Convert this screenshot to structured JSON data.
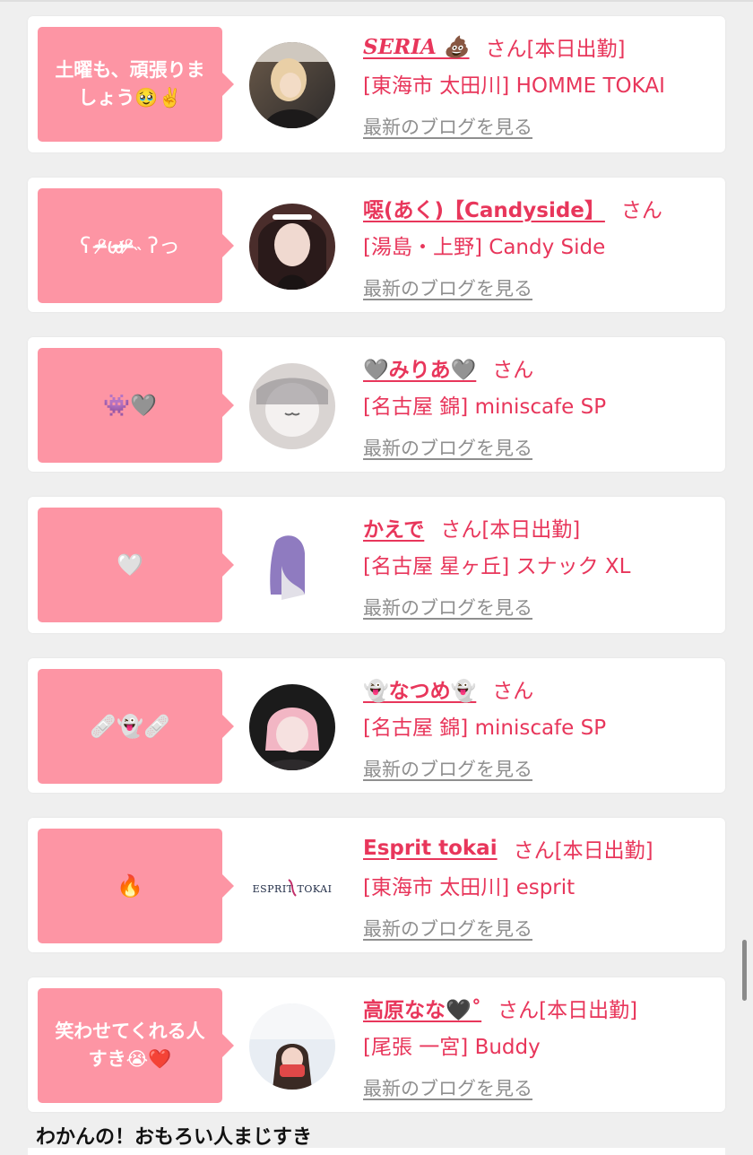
{
  "cards": [
    {
      "bubble": "土曜も、頑張りま\nしょう🥹✌️",
      "name": "SERIA 💩",
      "suffix": "さん[本日出勤]",
      "shop": "[東海市 太田川] HOMME TOKAI",
      "blog": "最新のブログを見る"
    },
    {
      "bubble": "ʕ ᵒ̴̶̷ω̴̶̷ᵒ̴̶̷˵ ʔっ",
      "name": "噁(あく)【Candyside】",
      "suffix": "さん",
      "shop": "[湯島・上野] Candy Side",
      "blog": "最新のブログを見る"
    },
    {
      "bubble": "👾🩶",
      "name": "🩶みりあ🩶",
      "suffix": "さん",
      "shop": "[名古屋 錦] miniscafe SP",
      "blog": "最新のブログを見る"
    },
    {
      "bubble": "🤍",
      "name": "かえで",
      "suffix": "さん[本日出勤]",
      "shop": "[名古屋 星ヶ丘] スナック XL",
      "blog": "最新のブログを見る"
    },
    {
      "bubble": "🩹👻🩹",
      "name": "👻なつめ👻",
      "suffix": "さん",
      "shop": "[名古屋 錦] miniscafe SP",
      "blog": "最新のブログを見る"
    },
    {
      "bubble": "🔥",
      "name": "Esprit tokai",
      "suffix": "さん[本日出勤]",
      "shop": "[東海市 太田川] esprit",
      "blog": "最新のブログを見る",
      "logo_text": "ESPRIT TOKAI"
    },
    {
      "bubble": "笑わせてくれる人\nすき😭❤️",
      "name": "高原なな🖤˚",
      "suffix": "さん[本日出勤]",
      "shop": "[尾張 一宮] Buddy",
      "blog": "最新のブログを見る"
    }
  ],
  "footer_comment": "わかんの！おもろい人まじすき",
  "colors": {
    "accent": "#e8365b",
    "bubble": "#fd95a4",
    "link_gray": "#8f8f8f",
    "background": "#efefef"
  }
}
